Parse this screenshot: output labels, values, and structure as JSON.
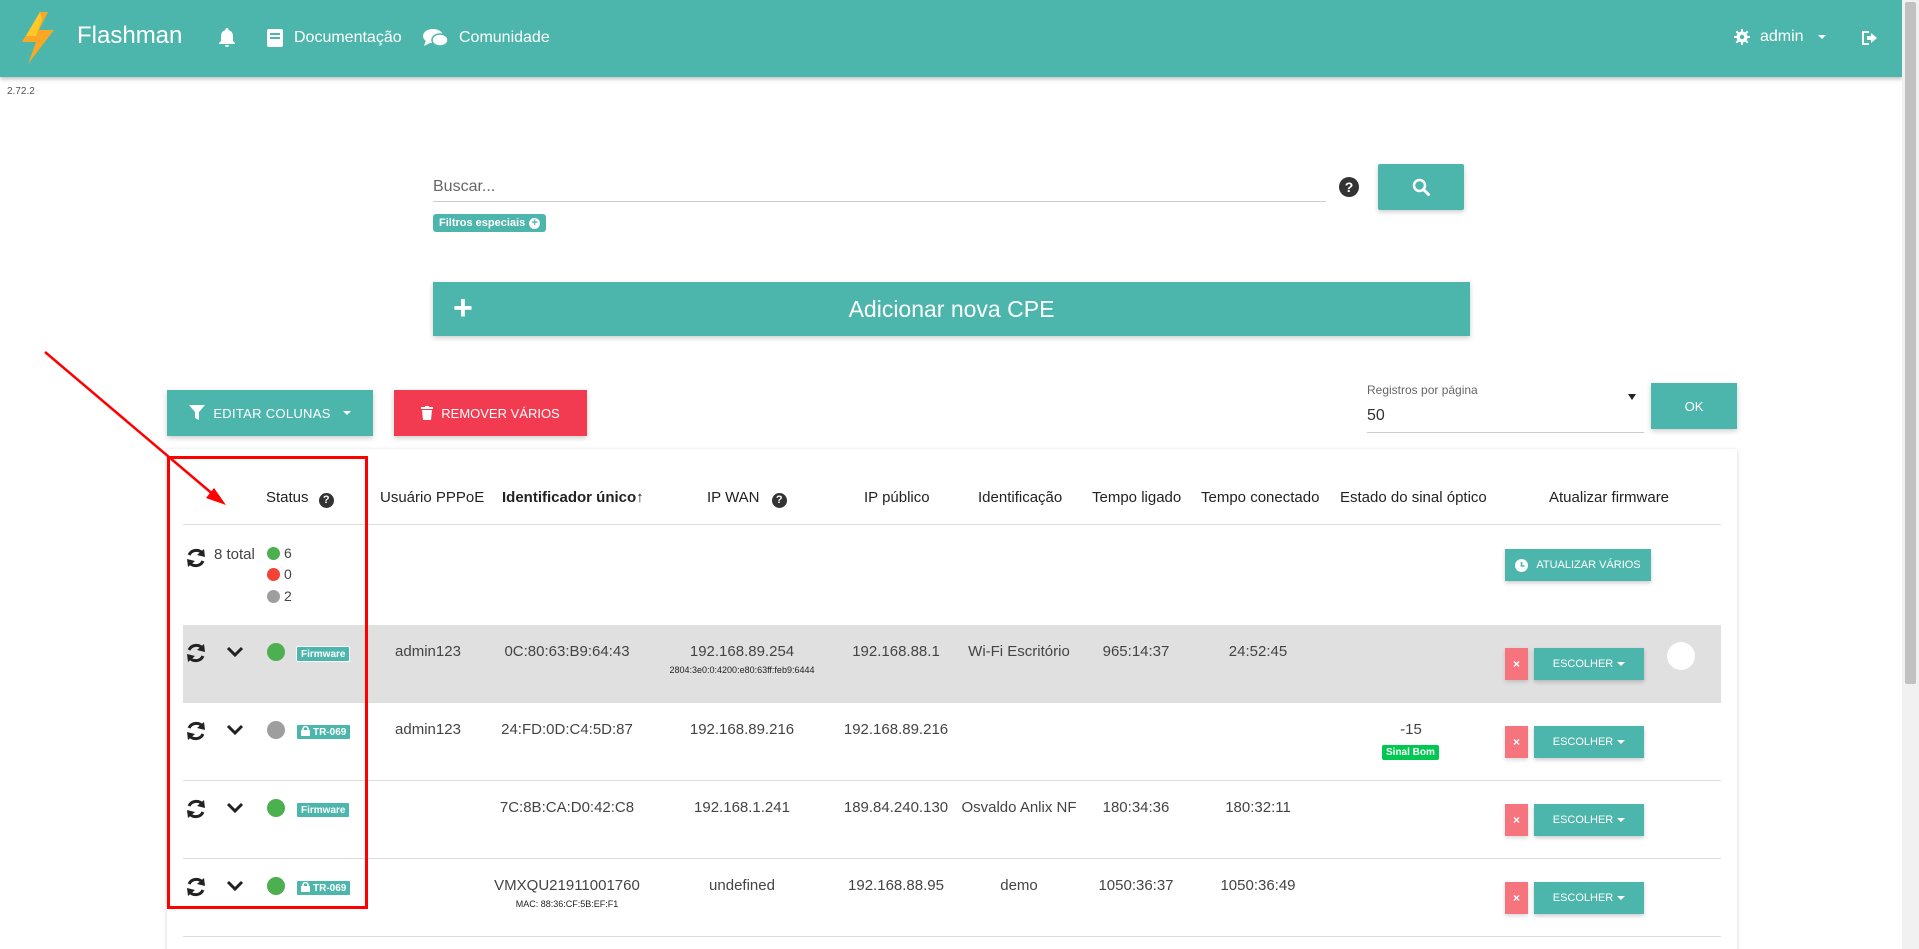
{
  "app": {
    "name": "Flashman",
    "version": "2.72.2"
  },
  "nav": {
    "docs_label": "Documentação",
    "community_label": "Comunidade",
    "user_label": "admin"
  },
  "search": {
    "placeholder": "Buscar...",
    "filters_label": "Filtros especiais"
  },
  "add_cpe_label": "Adicionar nova CPE",
  "actions": {
    "edit_columns": "EDITAR COLUNAS",
    "remove_many": "REMOVER VÁRIOS",
    "per_page_label": "Registros por página",
    "per_page_value": "50",
    "ok": "OK"
  },
  "table": {
    "headers": {
      "status": "Status",
      "pppoe": "Usuário PPPoE",
      "unique_id": "Identificador único↑",
      "ip_wan": "IP WAN",
      "ip_public": "IP público",
      "identification": "Identificação",
      "uptime": "Tempo ligado",
      "connected_time": "Tempo conectado",
      "optical": "Estado do sinal óptico",
      "firmware": "Atualizar firmware"
    },
    "summary": {
      "total": "8 total",
      "online": "6",
      "offline": "0",
      "unknown": "2",
      "update_many": "ATUALIZAR VÁRIOS"
    },
    "rows": [
      {
        "tag": "Firmware",
        "status": "green",
        "pppoe": "admin123",
        "unique_id": "0C:80:63:B9:64:43",
        "unique_sub": "",
        "ip_wan": "192.168.89.254",
        "ip_wan_sub": "2804:3e0:0:4200:e80:63ff:feb9:6444",
        "ip_public": "192.168.88.1",
        "identification": "Wi-Fi Escritório",
        "uptime": "965:14:37",
        "connected": "24:52:45",
        "optical": "",
        "optical_badge": "",
        "choose": "ESCOLHER",
        "remove": "×"
      },
      {
        "tag": "TR-069",
        "status": "gray",
        "pppoe": "admin123",
        "unique_id": "24:FD:0D:C4:5D:87",
        "unique_sub": "",
        "ip_wan": "192.168.89.216",
        "ip_wan_sub": "",
        "ip_public": "192.168.89.216",
        "identification": "",
        "uptime": "",
        "connected": "",
        "optical": "-15",
        "optical_badge": "Sinal Bom",
        "choose": "ESCOLHER",
        "remove": "×"
      },
      {
        "tag": "Firmware",
        "status": "green",
        "pppoe": "",
        "unique_id": "7C:8B:CA:D0:42:C8",
        "unique_sub": "",
        "ip_wan": "192.168.1.241",
        "ip_wan_sub": "",
        "ip_public": "189.84.240.130",
        "identification": "Osvaldo Anlix NF",
        "uptime": "180:34:36",
        "connected": "180:32:11",
        "optical": "",
        "optical_badge": "",
        "choose": "ESCOLHER",
        "remove": "×"
      },
      {
        "tag": "TR-069",
        "status": "green",
        "pppoe": "",
        "unique_id": "VMXQU21911001760",
        "unique_sub": "MAC: 88:36:CF:5B:EF:F1",
        "ip_wan": "undefined",
        "ip_wan_sub": "",
        "ip_public": "192.168.88.95",
        "identification": "demo",
        "uptime": "1050:36:37",
        "connected": "1050:36:49",
        "optical": "",
        "optical_badge": "",
        "choose": "ESCOLHER",
        "remove": "×"
      }
    ]
  },
  "colors": {
    "primary": "#4db6ac",
    "danger": "#f23b50",
    "online": "#4caf50",
    "offline": "#f44336",
    "unknown": "#9e9e9e",
    "annotation": "#ff0000"
  }
}
